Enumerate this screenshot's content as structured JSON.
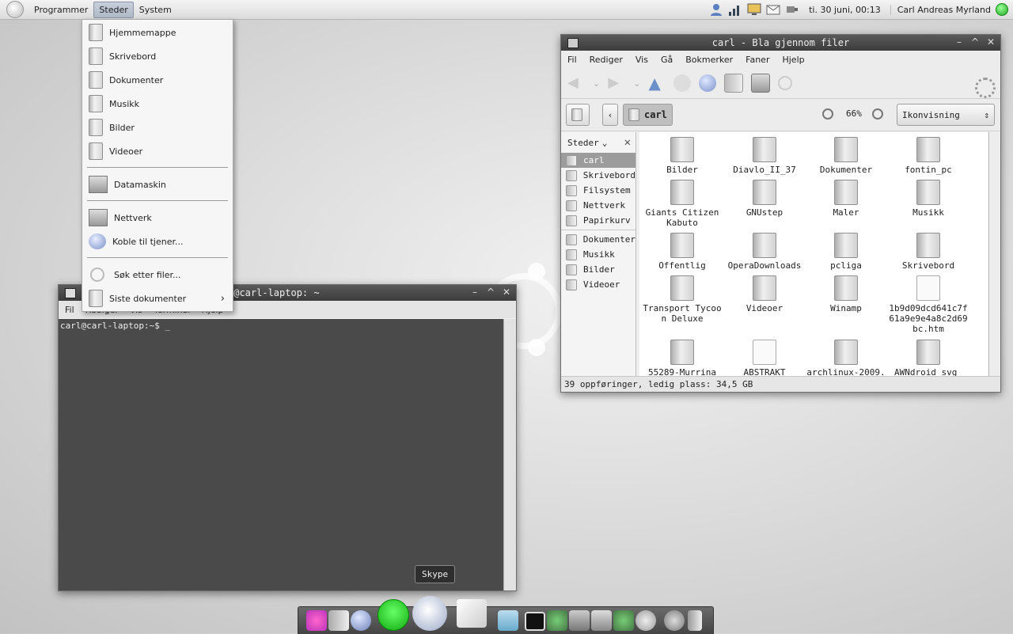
{
  "top_panel": {
    "menus": [
      "Programmer",
      "Steder",
      "System"
    ],
    "clock": "ti. 30 juni, 00:13",
    "user": "Carl Andreas Myrland"
  },
  "places_menu": {
    "items": [
      "Hjemmemappe",
      "Skrivebord",
      "Dokumenter",
      "Musikk",
      "Bilder",
      "Videoer"
    ],
    "computer": "Datamaskin",
    "network": [
      "Nettverk",
      "Koble til tjener..."
    ],
    "search": "Søk etter filer...",
    "recent": "Siste dokumenter"
  },
  "terminal": {
    "title": "carl@carl-laptop: ~",
    "title_visible": "l@carl-laptop: ~",
    "menus": [
      "Fil",
      "Rediger",
      "Vis",
      "Terminal",
      "Hjelp"
    ],
    "prompt": "carl@carl-laptop:~$ _"
  },
  "file_manager": {
    "title": "carl - Bla gjennom filer",
    "menus": [
      "Fil",
      "Rediger",
      "Vis",
      "Gå",
      "Bokmerker",
      "Faner",
      "Hjelp"
    ],
    "path": "carl",
    "zoom": "66%",
    "view": "Ikonvisning",
    "sidebar_title": "Steder",
    "sidebar_places": [
      "carl",
      "Skrivebord",
      "Filsystem",
      "Nettverk",
      "Papirkurv"
    ],
    "sidebar_bookmarks": [
      "Dokumenter",
      "Musikk",
      "Bilder",
      "Videoer"
    ],
    "files": [
      {
        "name": "Bilder",
        "kind": "folder"
      },
      {
        "name": "Diavlo_II_37",
        "kind": "folder"
      },
      {
        "name": "Dokumenter",
        "kind": "folder"
      },
      {
        "name": "fontin_pc",
        "kind": "folder"
      },
      {
        "name": "Giants Citizen Kabuto",
        "kind": "folder"
      },
      {
        "name": "GNUstep",
        "kind": "folder"
      },
      {
        "name": "Maler",
        "kind": "folder"
      },
      {
        "name": "Musikk",
        "kind": "folder"
      },
      {
        "name": "Offentlig",
        "kind": "folder"
      },
      {
        "name": "OperaDownloads",
        "kind": "folder"
      },
      {
        "name": "pcliga",
        "kind": "folder"
      },
      {
        "name": "Skrivebord",
        "kind": "desktop"
      },
      {
        "name": "Transport Tycoon Deluxe",
        "kind": "folder"
      },
      {
        "name": "Videoer",
        "kind": "folder"
      },
      {
        "name": "Winamp",
        "kind": "folder"
      },
      {
        "name": "1b9d09dcd641c7f61a9e9e4a8c2d69bc.htm",
        "kind": "doc"
      },
      {
        "name": "55289-Murrina",
        "kind": "package"
      },
      {
        "name": "ABSTRAKT",
        "kind": "doc"
      },
      {
        "name": "archlinux-2009.",
        "kind": "disc"
      },
      {
        "name": "AWNdroid_svg_",
        "kind": "package"
      }
    ],
    "status": "39 oppføringer, ledig plass: 34,5 GB"
  },
  "tooltip": "Skype",
  "colors": {
    "panel_active": "#aeb8c6",
    "terminal_bg": "#4a4a4a",
    "sidebar_selected": "#9c9c9c"
  }
}
